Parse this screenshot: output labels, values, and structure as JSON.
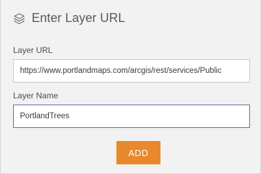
{
  "header": {
    "icon": "layers-icon",
    "title": "Enter Layer URL"
  },
  "form": {
    "layer_url_label": "Layer URL",
    "layer_url_value": "https://www.portlandmaps.com/arcgis/rest/services/Public",
    "layer_name_label": "Layer Name",
    "layer_name_value": "PortlandTrees",
    "add_button_label": "ADD"
  },
  "colors": {
    "accent": "#e8892d",
    "background": "#f2f2f2",
    "focused_border": "#5a6f8a"
  }
}
